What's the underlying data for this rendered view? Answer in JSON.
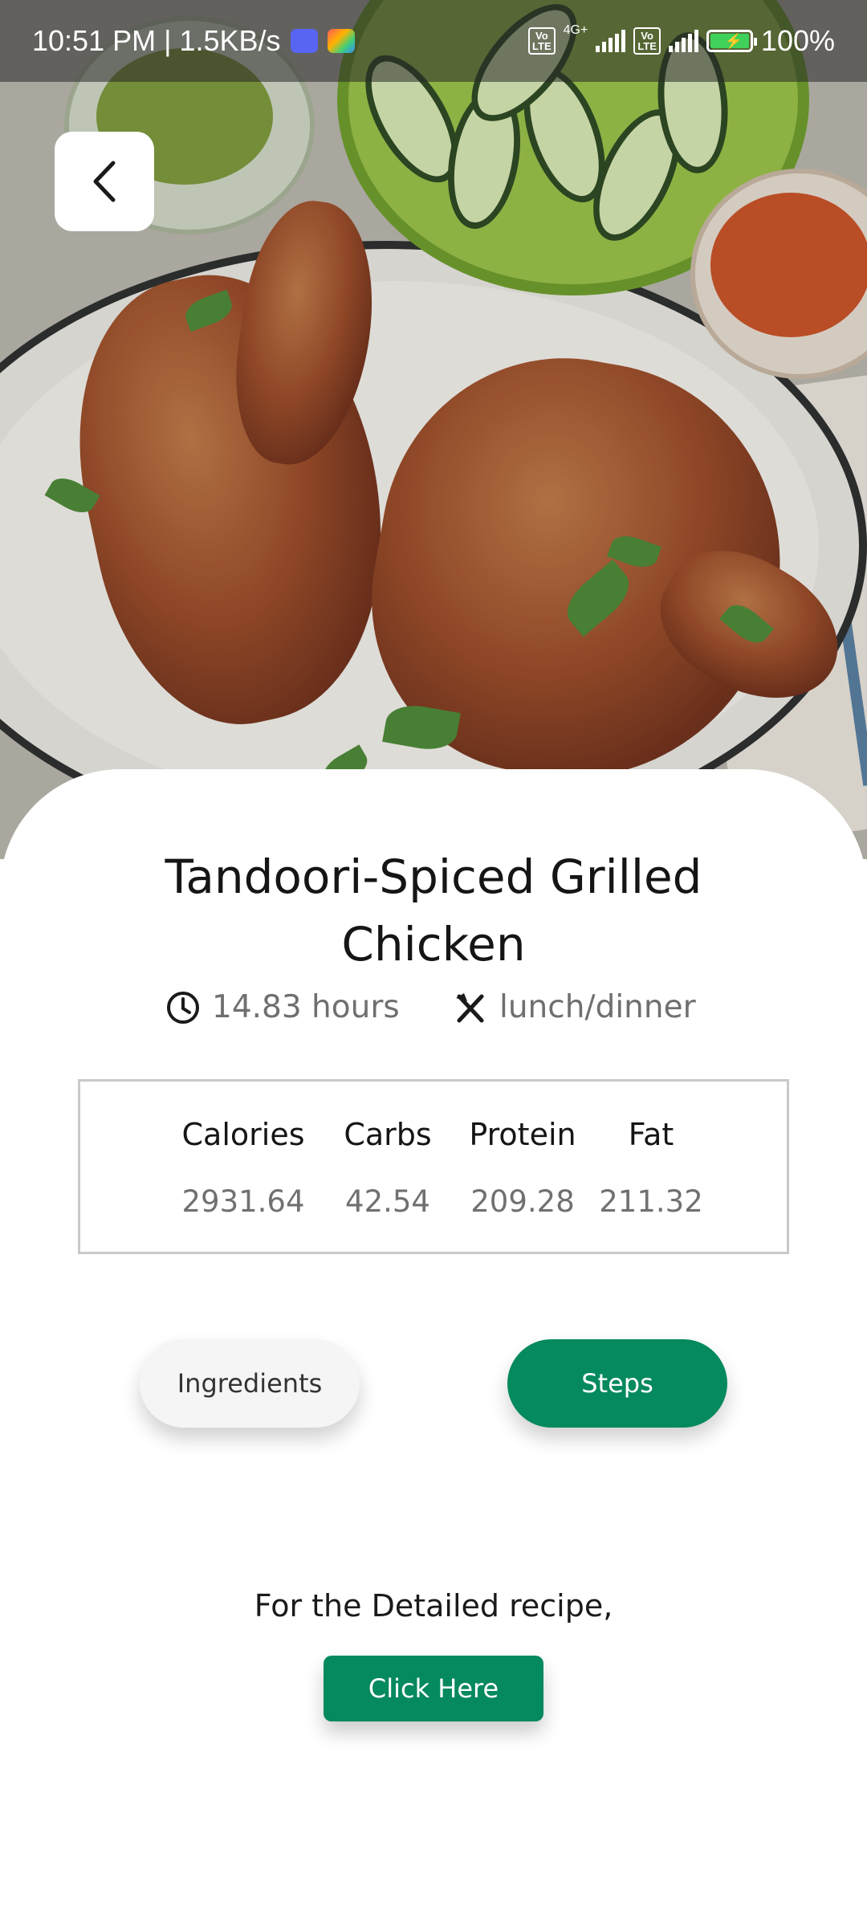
{
  "status_bar": {
    "time_speed": "10:51 PM | 1.5KB/s",
    "network_label": "4G+",
    "volte_label": "Vo\nLTE",
    "battery_text": "100%"
  },
  "recipe": {
    "title": "Tandoori-Spiced Grilled Chicken",
    "time": "14.83 hours",
    "meal_type": "lunch/dinner"
  },
  "nutrition": [
    {
      "label": "Calories",
      "value": "2931.64"
    },
    {
      "label": "Carbs",
      "value": "42.54"
    },
    {
      "label": "Protein",
      "value": "209.28"
    },
    {
      "label": "Fat",
      "value": "211.32"
    }
  ],
  "tabs": {
    "ingredients_label": "Ingredients",
    "steps_label": "Steps",
    "active": "Steps"
  },
  "detail": {
    "prompt": "For the Detailed recipe,",
    "button_label": "Click Here"
  },
  "colors": {
    "accent": "#05895f",
    "inactive_tab": "#f5f5f5",
    "title_text": "#151515",
    "muted_text": "#707070"
  },
  "icons": {
    "back": "chevron-left-icon",
    "time": "clock-icon",
    "meal": "fork-knife-icon"
  }
}
